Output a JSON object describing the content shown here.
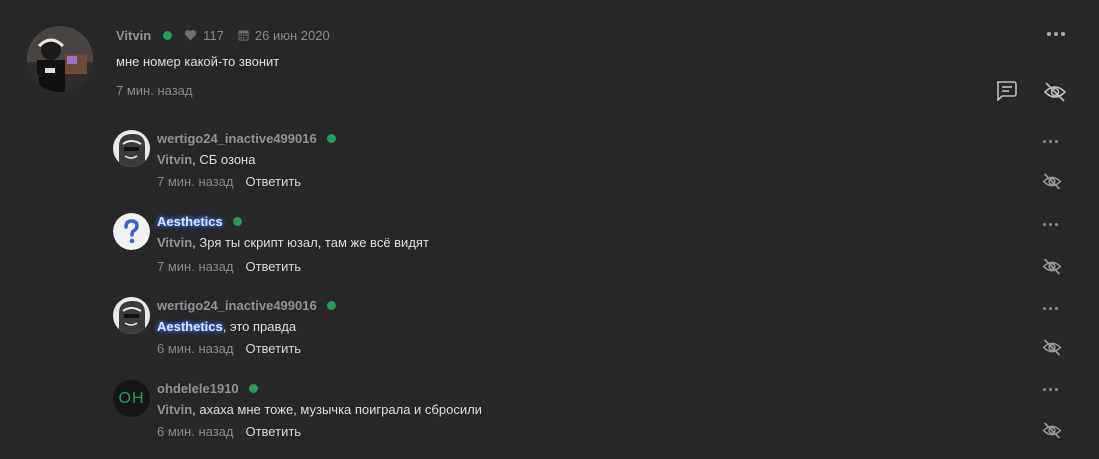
{
  "post": {
    "author": "Vitvin",
    "likes": "117",
    "date": "26 июн 2020",
    "text": "мне номер какой-то звонит",
    "time": "7 мин. назад"
  },
  "replies": [
    {
      "author": "wertigo24_inactive499016",
      "mention": "Vitvin",
      "text": ", СБ озона",
      "time": "7 мин. назад",
      "answer": "Ответить"
    },
    {
      "author": "Aesthetics",
      "mention": "Vitvin",
      "text": ", Зря ты скрипт юзал, там же всё видят",
      "time": "7 мин. назад",
      "answer": "Ответить"
    },
    {
      "author": "wertigo24_inactive499016",
      "mention": "Aesthetics",
      "text": ", это правда",
      "time": "6 мин. назад",
      "answer": "Ответить"
    },
    {
      "author": "ohdelele1910",
      "avatar_initials": "OH",
      "mention": "Vitvin",
      "text": ", ахаха мне тоже, музычка поиграла и сбросили",
      "time": "6 мин. назад",
      "answer": "Ответить"
    }
  ],
  "colors": {
    "background": "#272727",
    "online": "#1f9e5e",
    "glow": "#4b7dff"
  },
  "icons": {
    "like": "heart-icon",
    "date": "calendar-icon",
    "reply": "comment-icon",
    "hide": "eye-off-icon",
    "menu": "more-dots-icon",
    "unknown_avatar": "question-mark-icon"
  }
}
